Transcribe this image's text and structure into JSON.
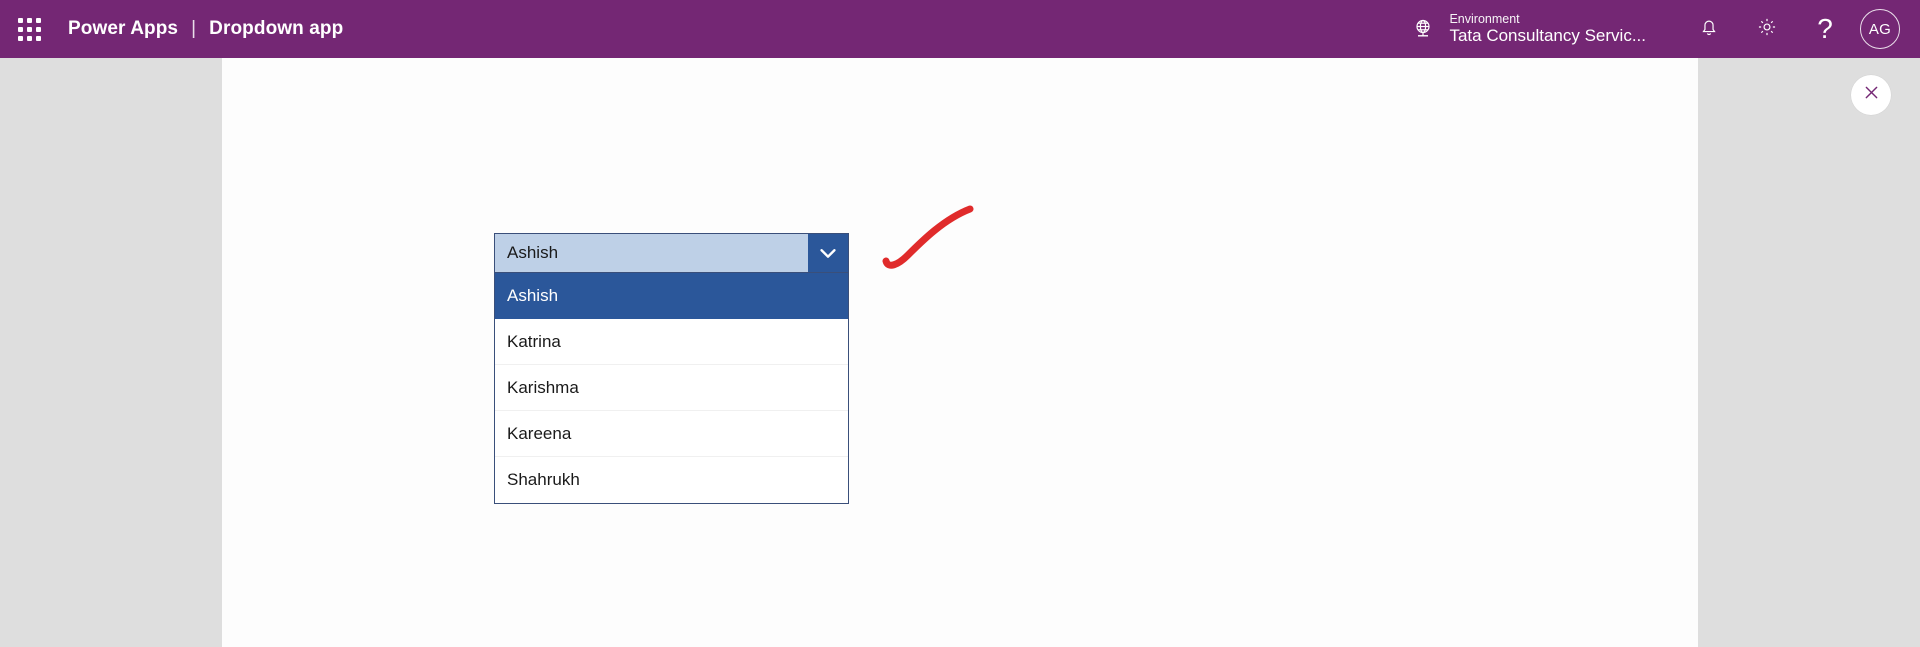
{
  "topbar": {
    "waffle_icon": "app-launcher-grid-icon",
    "product": "Power Apps",
    "separator": "|",
    "app_name": "Dropdown app",
    "environment": {
      "icon": "globe-environment-icon",
      "label": "Environment",
      "name": "Tata Consultancy Servic..."
    },
    "notifications_icon": "bell-icon",
    "settings_icon": "gear-icon",
    "help_icon": "question-mark-icon",
    "avatar_initials": "AG",
    "background_color": "#742774"
  },
  "close_button": {
    "icon": "close-x-icon",
    "color": "#742774"
  },
  "dropdown": {
    "selected_value": "Ashish",
    "chevron_icon": "chevron-down-icon",
    "expanded": true,
    "field_fill": "#bed0e7",
    "border_color": "#3a4f7a",
    "button_fill": "#2b579a",
    "highlight_fill": "#2b579a",
    "options": [
      {
        "label": "Ashish",
        "selected": true
      },
      {
        "label": "Katrina",
        "selected": false
      },
      {
        "label": "Karishma",
        "selected": false
      },
      {
        "label": "Kareena",
        "selected": false
      },
      {
        "label": "Shahrukh",
        "selected": false
      }
    ]
  },
  "annotation": {
    "name": "red-swoosh-mark",
    "color": "#e02b2b"
  },
  "canvas": {
    "background": "#fdfdfd",
    "stage_background": "#dedede"
  }
}
